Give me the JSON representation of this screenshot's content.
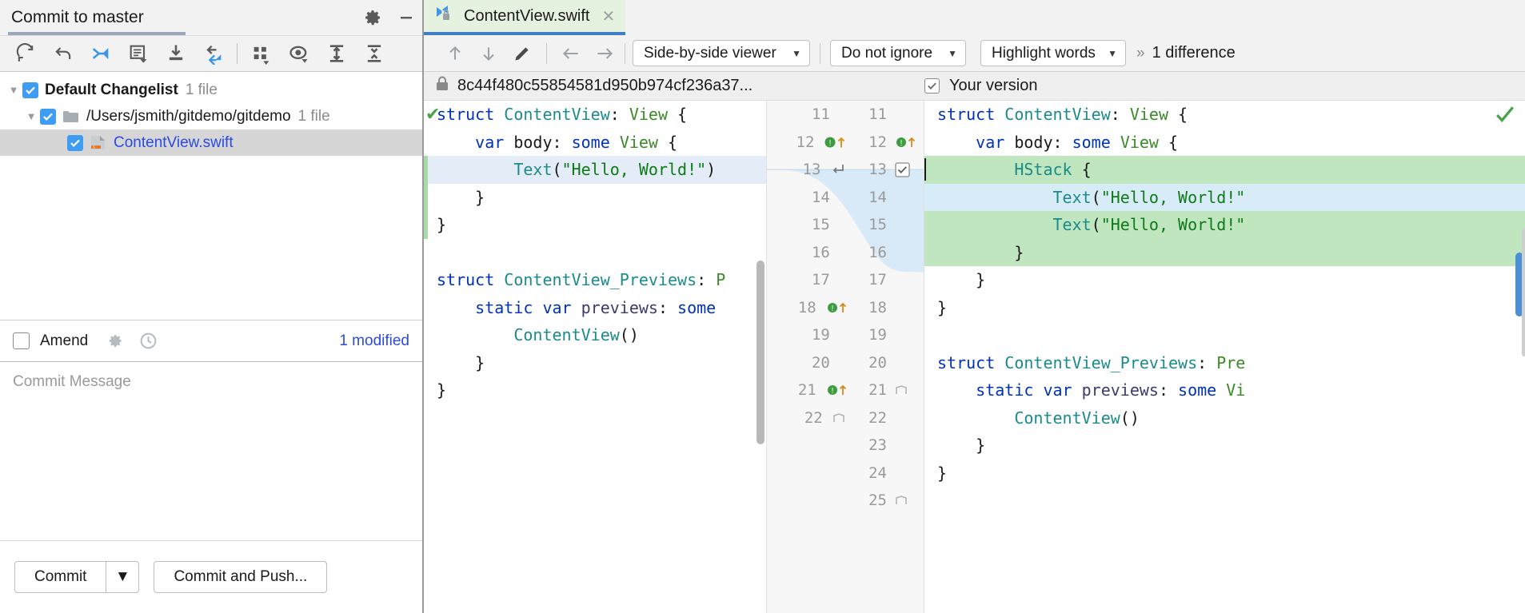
{
  "commit_panel": {
    "title": "Commit to master",
    "header_icons": [
      {
        "name": "gear-icon",
        "label": "Settings"
      },
      {
        "name": "minimize-icon",
        "label": "Minimize"
      }
    ],
    "toolbar": [
      {
        "name": "refresh-icon",
        "label": "Refresh changes"
      },
      {
        "name": "revert-icon",
        "label": "Rollback"
      },
      {
        "name": "move-to-changelist-icon",
        "label": "Move to another changelist"
      },
      {
        "name": "edit-changelist-icon",
        "label": "Edit changelist"
      },
      {
        "name": "shelve-icon",
        "label": "Shelve changes"
      },
      {
        "name": "diff-icon",
        "label": "Show diff"
      },
      {
        "name": "group-by-icon",
        "label": "Group by"
      },
      {
        "name": "preview-icon",
        "label": "Preview"
      },
      {
        "name": "expand-all-icon",
        "label": "Expand all"
      },
      {
        "name": "collapse-all-icon",
        "label": "Collapse all"
      }
    ],
    "tree": {
      "changelist": {
        "label": "Default Changelist",
        "count": "1 file",
        "checked": true
      },
      "folder": {
        "label": "/Users/jsmith/gitdemo/gitdemo",
        "count": "1 file",
        "checked": true
      },
      "file": {
        "label": "ContentView.swift",
        "checked": true,
        "selected": true
      }
    },
    "amend": {
      "label": "Amend",
      "checked": false,
      "icons": [
        {
          "name": "gear-icon"
        },
        {
          "name": "history-clock-icon"
        }
      ],
      "status": "1 modified"
    },
    "message": {
      "placeholder": "Commit Message",
      "value": ""
    },
    "buttons": {
      "commit": "Commit",
      "commit_dropdown": "▼",
      "commit_and_push": "Commit and Push..."
    }
  },
  "diff_panel": {
    "tab": {
      "label": "ContentView.swift",
      "close": "✕",
      "icon": "diff-lock-icon"
    },
    "toolbar": {
      "prev_difference": "↑",
      "next_difference": "↓",
      "edit_source": "edit-pencil-icon",
      "accept_left": "←",
      "accept_right": "→",
      "viewer_mode": "Side-by-side viewer",
      "ignore_mode": "Do not ignore",
      "highlight_mode": "Highlight words",
      "overflow": "»",
      "difference_count": "1 difference"
    },
    "left_header": {
      "revision": "8c44f480c55854581d950b974cf236a37...",
      "icon": "lock-icon"
    },
    "right_header": {
      "label": "Your version",
      "checked": true
    }
  },
  "diff_content": {
    "left_lines": [
      {
        "tokens": [
          {
            "t": "struct ",
            "c": "kw"
          },
          {
            "t": "ContentView",
            "c": "typ"
          },
          {
            "t": ": ",
            "c": "pln"
          },
          {
            "t": "View",
            "c": "vw"
          },
          {
            "t": " {",
            "c": "pln"
          }
        ],
        "hl": "",
        "marker": "check"
      },
      {
        "tokens": [
          {
            "t": "    var ",
            "c": "kw"
          },
          {
            "t": "body",
            "c": "pln"
          },
          {
            "t": ": ",
            "c": "pln"
          },
          {
            "t": "some ",
            "c": "kw"
          },
          {
            "t": "View",
            "c": "vw"
          },
          {
            "t": " {",
            "c": "pln"
          }
        ],
        "hl": ""
      },
      {
        "tokens": [
          {
            "t": "        ",
            "c": "pln"
          },
          {
            "t": "Text",
            "c": "typ"
          },
          {
            "t": "(",
            "c": "pln"
          },
          {
            "t": "\"Hello, World!\"",
            "c": "str"
          },
          {
            "t": ")",
            "c": "pln"
          }
        ],
        "hl": "blue"
      },
      {
        "tokens": [
          {
            "t": "    }",
            "c": "pln"
          }
        ],
        "hl": ""
      },
      {
        "tokens": [
          {
            "t": "}",
            "c": "pln"
          }
        ],
        "hl": ""
      },
      {
        "tokens": [
          {
            "t": "",
            "c": "pln"
          }
        ],
        "hl": ""
      },
      {
        "tokens": [
          {
            "t": "struct ",
            "c": "kw"
          },
          {
            "t": "ContentView_Previews",
            "c": "typ"
          },
          {
            "t": ": ",
            "c": "pln"
          },
          {
            "t": "P",
            "c": "vw"
          }
        ],
        "hl": ""
      },
      {
        "tokens": [
          {
            "t": "    static var ",
            "c": "kw"
          },
          {
            "t": "previews",
            "c": "mod"
          },
          {
            "t": ": ",
            "c": "pln"
          },
          {
            "t": "some",
            "c": "kw"
          }
        ],
        "hl": ""
      },
      {
        "tokens": [
          {
            "t": "        ",
            "c": "pln"
          },
          {
            "t": "ContentView",
            "c": "typ"
          },
          {
            "t": "()",
            "c": "pln"
          }
        ],
        "hl": ""
      },
      {
        "tokens": [
          {
            "t": "    }",
            "c": "pln"
          }
        ],
        "hl": ""
      },
      {
        "tokens": [
          {
            "t": "}",
            "c": "pln"
          }
        ],
        "hl": ""
      }
    ],
    "right_lines": [
      {
        "tokens": [
          {
            "t": "struct ",
            "c": "kw"
          },
          {
            "t": "ContentView",
            "c": "typ"
          },
          {
            "t": ": ",
            "c": "pln"
          },
          {
            "t": "View",
            "c": "vw"
          },
          {
            "t": " {",
            "c": "pln"
          }
        ],
        "hl": ""
      },
      {
        "tokens": [
          {
            "t": "    var ",
            "c": "kw"
          },
          {
            "t": "body",
            "c": "pln"
          },
          {
            "t": ": ",
            "c": "pln"
          },
          {
            "t": "some ",
            "c": "kw"
          },
          {
            "t": "View",
            "c": "vw"
          },
          {
            "t": " {",
            "c": "pln"
          }
        ],
        "hl": ""
      },
      {
        "tokens": [
          {
            "t": "        ",
            "c": "pln"
          },
          {
            "t": "HStack",
            "c": "typ"
          },
          {
            "t": " {",
            "c": "pln"
          }
        ],
        "hl": "green"
      },
      {
        "tokens": [
          {
            "t": "            ",
            "c": "pln"
          },
          {
            "t": "Text",
            "c": "typ"
          },
          {
            "t": "(",
            "c": "pln"
          },
          {
            "t": "\"Hello, World!\"",
            "c": "str"
          }
        ],
        "hl": "greenin"
      },
      {
        "tokens": [
          {
            "t": "            ",
            "c": "pln"
          },
          {
            "t": "Text",
            "c": "typ"
          },
          {
            "t": "(",
            "c": "pln"
          },
          {
            "t": "\"Hello, World!\"",
            "c": "str"
          }
        ],
        "hl": "green"
      },
      {
        "tokens": [
          {
            "t": "        }",
            "c": "pln"
          }
        ],
        "hl": "green"
      },
      {
        "tokens": [
          {
            "t": "    }",
            "c": "pln"
          }
        ],
        "hl": ""
      },
      {
        "tokens": [
          {
            "t": "}",
            "c": "pln"
          }
        ],
        "hl": ""
      },
      {
        "tokens": [
          {
            "t": "",
            "c": "pln"
          }
        ],
        "hl": ""
      },
      {
        "tokens": [
          {
            "t": "struct ",
            "c": "kw"
          },
          {
            "t": "ContentView_Previews",
            "c": "typ"
          },
          {
            "t": ": ",
            "c": "pln"
          },
          {
            "t": "Pre",
            "c": "vw"
          }
        ],
        "hl": ""
      },
      {
        "tokens": [
          {
            "t": "    static var ",
            "c": "kw"
          },
          {
            "t": "previews",
            "c": "mod"
          },
          {
            "t": ": ",
            "c": "pln"
          },
          {
            "t": "some ",
            "c": "kw"
          },
          {
            "t": "Vi",
            "c": "vw"
          }
        ],
        "hl": ""
      },
      {
        "tokens": [
          {
            "t": "        ",
            "c": "pln"
          },
          {
            "t": "ContentView",
            "c": "typ"
          },
          {
            "t": "()",
            "c": "pln"
          }
        ],
        "hl": ""
      },
      {
        "tokens": [
          {
            "t": "    }",
            "c": "pln"
          }
        ],
        "hl": ""
      },
      {
        "tokens": [
          {
            "t": "}",
            "c": "pln"
          }
        ],
        "hl": ""
      }
    ],
    "gutter_rows": [
      {
        "left": "11",
        "right": "11",
        "lmark": "",
        "rmark": ""
      },
      {
        "left": "12",
        "right": "12",
        "lmark": "warn-up",
        "rmark": "warn-up"
      },
      {
        "left": "13",
        "right": "13",
        "lmark": "apply-left",
        "rmark": "checkbox"
      },
      {
        "left": "14",
        "right": "14",
        "lmark": "",
        "rmark": ""
      },
      {
        "left": "15",
        "right": "15",
        "lmark": "",
        "rmark": ""
      },
      {
        "left": "16",
        "right": "16",
        "lmark": "",
        "rmark": ""
      },
      {
        "left": "17",
        "right": "17",
        "lmark": "",
        "rmark": ""
      },
      {
        "left": "18",
        "right": "18",
        "lmark": "warn-up-fold",
        "rmark": ""
      },
      {
        "left": "19",
        "right": "19",
        "lmark": "",
        "rmark": ""
      },
      {
        "left": "20",
        "right": "20",
        "lmark": "",
        "rmark": ""
      },
      {
        "left": "21",
        "right": "21",
        "lmark": "warn-up",
        "rmark": "fold"
      },
      {
        "left": "22",
        "right": "22",
        "lmark": "fold",
        "rmark": ""
      },
      {
        "left": "",
        "right": "23",
        "lmark": "",
        "rmark": ""
      },
      {
        "left": "",
        "right": "24",
        "lmark": "",
        "rmark": ""
      },
      {
        "left": "",
        "right": "25",
        "lmark": "",
        "rmark": "fold"
      }
    ]
  }
}
